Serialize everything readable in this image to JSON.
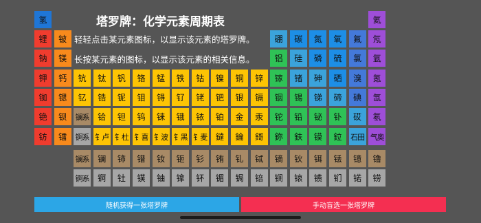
{
  "colors": {
    "background": "#555555",
    "alkali": "#F03C2E",
    "alkaline_earth": "#F88A1C",
    "transition": "#FDC404",
    "post_transition": "#2FC256",
    "metalloid": "#3BA3DB",
    "nonmetal": "#1D8EE6",
    "halogen": "#4479D9",
    "noble_gas": "#9E4ED8",
    "lanthanide": "#A88A66",
    "actinide": "#A6A6A6",
    "hydrogen": "#1F76D6",
    "button_random": "#2CA6E6",
    "button_manual": "#F42F51"
  },
  "header": {
    "title": "塔罗牌：化学元素周期表",
    "instructions": [
      "轻轻点击某元素图标，以显示该元素的塔罗牌。",
      "长按某元素的图标，以显示该元素的相关信息。"
    ]
  },
  "elements": [
    {
      "s": "氢",
      "c": "hydrogen"
    },
    {
      "s": "氦",
      "c": "noble_gas"
    },
    {
      "s": "锂",
      "c": "alkali"
    },
    {
      "s": "铍",
      "c": "alkaline_earth"
    },
    {
      "s": "硼",
      "c": "metalloid"
    },
    {
      "s": "碳",
      "c": "nonmetal"
    },
    {
      "s": "氮",
      "c": "nonmetal"
    },
    {
      "s": "氧",
      "c": "nonmetal"
    },
    {
      "s": "氟",
      "c": "halogen"
    },
    {
      "s": "氖",
      "c": "noble_gas"
    },
    {
      "s": "钠",
      "c": "alkali"
    },
    {
      "s": "镁",
      "c": "alkaline_earth"
    },
    {
      "s": "铝",
      "c": "post_transition"
    },
    {
      "s": "硅",
      "c": "metalloid"
    },
    {
      "s": "磷",
      "c": "nonmetal"
    },
    {
      "s": "硫",
      "c": "nonmetal"
    },
    {
      "s": "氯",
      "c": "halogen"
    },
    {
      "s": "氩",
      "c": "noble_gas"
    },
    {
      "s": "钾",
      "c": "alkali"
    },
    {
      "s": "钙",
      "c": "alkaline_earth"
    },
    {
      "s": "钪",
      "c": "transition"
    },
    {
      "s": "钛",
      "c": "transition"
    },
    {
      "s": "钒",
      "c": "transition"
    },
    {
      "s": "铬",
      "c": "transition"
    },
    {
      "s": "锰",
      "c": "transition"
    },
    {
      "s": "铁",
      "c": "transition"
    },
    {
      "s": "钴",
      "c": "transition"
    },
    {
      "s": "镍",
      "c": "transition"
    },
    {
      "s": "铜",
      "c": "transition"
    },
    {
      "s": "锌",
      "c": "transition"
    },
    {
      "s": "镓",
      "c": "post_transition"
    },
    {
      "s": "锗",
      "c": "metalloid"
    },
    {
      "s": "砷",
      "c": "metalloid"
    },
    {
      "s": "硒",
      "c": "nonmetal"
    },
    {
      "s": "溴",
      "c": "halogen"
    },
    {
      "s": "氪",
      "c": "noble_gas"
    },
    {
      "s": "铷",
      "c": "alkali"
    },
    {
      "s": "锶",
      "c": "alkaline_earth"
    },
    {
      "s": "钇",
      "c": "transition"
    },
    {
      "s": "锆",
      "c": "transition"
    },
    {
      "s": "铌",
      "c": "transition"
    },
    {
      "s": "钼",
      "c": "transition"
    },
    {
      "s": "锝",
      "c": "transition"
    },
    {
      "s": "钌",
      "c": "transition"
    },
    {
      "s": "铑",
      "c": "transition"
    },
    {
      "s": "钯",
      "c": "transition"
    },
    {
      "s": "银",
      "c": "transition"
    },
    {
      "s": "镉",
      "c": "transition"
    },
    {
      "s": "铟",
      "c": "post_transition"
    },
    {
      "s": "锡",
      "c": "post_transition"
    },
    {
      "s": "锑",
      "c": "metalloid"
    },
    {
      "s": "碲",
      "c": "metalloid"
    },
    {
      "s": "碘",
      "c": "halogen"
    },
    {
      "s": "氙",
      "c": "noble_gas"
    },
    {
      "s": "铯",
      "c": "alkali"
    },
    {
      "s": "钡",
      "c": "alkaline_earth"
    },
    {
      "s": "镧系",
      "c": "lanthanide"
    },
    {
      "s": "铪",
      "c": "transition"
    },
    {
      "s": "钽",
      "c": "transition"
    },
    {
      "s": "钨",
      "c": "transition"
    },
    {
      "s": "铼",
      "c": "transition"
    },
    {
      "s": "锇",
      "c": "transition"
    },
    {
      "s": "铱",
      "c": "transition"
    },
    {
      "s": "铂",
      "c": "transition"
    },
    {
      "s": "金",
      "c": "transition"
    },
    {
      "s": "汞",
      "c": "transition"
    },
    {
      "s": "铊",
      "c": "post_transition"
    },
    {
      "s": "铅",
      "c": "post_transition"
    },
    {
      "s": "铋",
      "c": "post_transition"
    },
    {
      "s": "钋",
      "c": "post_transition"
    },
    {
      "s": "砹",
      "c": "metalloid"
    },
    {
      "s": "氡",
      "c": "noble_gas"
    },
    {
      "s": "钫",
      "c": "alkali"
    },
    {
      "s": "镭",
      "c": "alkaline_earth"
    },
    {
      "s": "锕系",
      "c": "actinide"
    },
    {
      "s": "钅卢",
      "c": "transition"
    },
    {
      "s": "钅杜",
      "c": "transition"
    },
    {
      "s": "钅喜",
      "c": "transition"
    },
    {
      "s": "钅波",
      "c": "transition"
    },
    {
      "s": "钅黑",
      "c": "transition"
    },
    {
      "s": "钅麦",
      "c": "transition"
    },
    {
      "s": "鐽",
      "c": "transition"
    },
    {
      "s": "錀",
      "c": "transition"
    },
    {
      "s": "鎶",
      "c": "transition"
    },
    {
      "s": "鉨",
      "c": "post_transition"
    },
    {
      "s": "鈇",
      "c": "post_transition"
    },
    {
      "s": "镆",
      "c": "post_transition"
    },
    {
      "s": "鉝",
      "c": "post_transition"
    },
    {
      "s": "石田",
      "c": "metalloid"
    },
    {
      "s": "气奥",
      "c": "noble_gas"
    },
    {
      "s": "镧系",
      "c": "lanthanide"
    },
    {
      "s": "镧",
      "c": "lanthanide"
    },
    {
      "s": "铈",
      "c": "lanthanide"
    },
    {
      "s": "镨",
      "c": "lanthanide"
    },
    {
      "s": "钕",
      "c": "lanthanide"
    },
    {
      "s": "钷",
      "c": "lanthanide"
    },
    {
      "s": "钐",
      "c": "lanthanide"
    },
    {
      "s": "铕",
      "c": "lanthanide"
    },
    {
      "s": "钆",
      "c": "lanthanide"
    },
    {
      "s": "铽",
      "c": "lanthanide"
    },
    {
      "s": "镝",
      "c": "lanthanide"
    },
    {
      "s": "钬",
      "c": "lanthanide"
    },
    {
      "s": "铒",
      "c": "lanthanide"
    },
    {
      "s": "铥",
      "c": "lanthanide"
    },
    {
      "s": "镱",
      "c": "lanthanide"
    },
    {
      "s": "镥",
      "c": "lanthanide"
    },
    {
      "s": "锕系",
      "c": "actinide"
    },
    {
      "s": "锕",
      "c": "actinide"
    },
    {
      "s": "钍",
      "c": "actinide"
    },
    {
      "s": "镤",
      "c": "actinide"
    },
    {
      "s": "铀",
      "c": "actinide"
    },
    {
      "s": "镎",
      "c": "actinide"
    },
    {
      "s": "钚",
      "c": "actinide"
    },
    {
      "s": "镅",
      "c": "actinide"
    },
    {
      "s": "锔",
      "c": "actinide"
    },
    {
      "s": "锫",
      "c": "actinide"
    },
    {
      "s": "锎",
      "c": "actinide"
    },
    {
      "s": "锿",
      "c": "actinide"
    },
    {
      "s": "镄",
      "c": "actinide"
    },
    {
      "s": "钔",
      "c": "actinide"
    },
    {
      "s": "锘",
      "c": "actinide"
    },
    {
      "s": "铹",
      "c": "actinide"
    }
  ],
  "buttons": {
    "random": "随机获得一张塔罗牌",
    "manual": "手动盲选一张塔罗牌"
  }
}
